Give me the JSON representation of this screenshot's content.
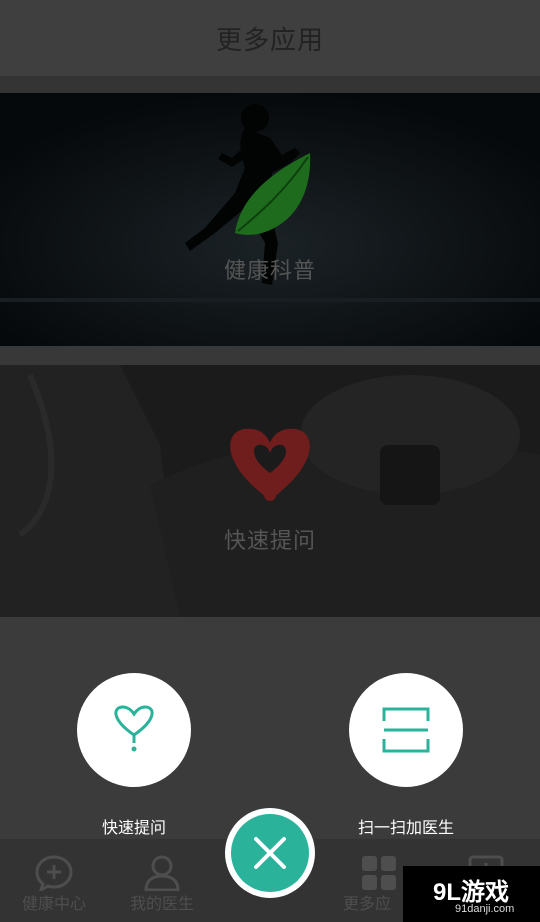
{
  "header": {
    "title": "更多应用"
  },
  "cards": [
    {
      "label": "健康科普"
    },
    {
      "label": "快速提问"
    }
  ],
  "actions": [
    {
      "label": "快速提问",
      "icon": "heart-question-icon"
    },
    {
      "label": "扫一扫加医生",
      "icon": "scan-icon"
    }
  ],
  "tabs": [
    {
      "label": "健康中心",
      "icon": "plus-chat-icon"
    },
    {
      "label": "我的医生",
      "icon": "doctor-icon"
    },
    {
      "label": "更多应",
      "icon": "grid-icon"
    }
  ],
  "watermark": {
    "logo": "9L游戏",
    "url": "91danji.com"
  },
  "colors": {
    "accent": "#2ab39a",
    "leaf": "#1e6b1e",
    "heart": "#7a1e1e"
  }
}
